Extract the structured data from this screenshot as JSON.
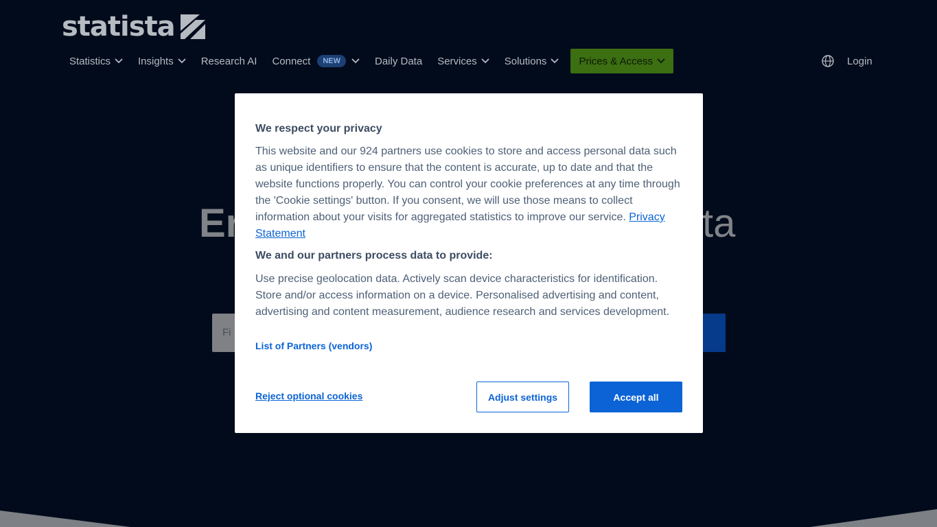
{
  "brand": {
    "name": "statista"
  },
  "nav": {
    "items": [
      {
        "label": "Statistics",
        "dropdown": true
      },
      {
        "label": "Insights",
        "dropdown": true
      },
      {
        "label": "Research AI",
        "dropdown": false
      },
      {
        "label": "Connect",
        "badge": "NEW",
        "dropdown": true
      },
      {
        "label": "Daily Data",
        "dropdown": false
      },
      {
        "label": "Services",
        "dropdown": true
      },
      {
        "label": "Solutions",
        "dropdown": true
      },
      {
        "label": "Prices & Access",
        "dropdown": true,
        "highlight": true
      }
    ],
    "login": "Login"
  },
  "hero": {
    "title_visible_start": "Er",
    "title_visible_end": "ta",
    "search_placeholder_fragment": "Fi"
  },
  "cookie_modal": {
    "title": "We respect your privacy",
    "body": "This website and our 924 partners use cookies to store and access personal data such as unique identifiers to ensure that the content is accurate, up to date and that the website functions properly. You can control your cookie preferences at any time through the 'Cookie settings' button. If you consent, we will use those means to collect information about your visits for aggregated statistics to improve our service.",
    "privacy_link": "Privacy Statement",
    "subtitle": "We and our partners process data to provide:",
    "purposes": "Use precise geolocation data. Actively scan device characteristics for identification. Store and/or access information on a device. Personalised advertising and content, advertising and content measurement, audience research and services development.",
    "partners_link": "List of Partners (vendors)",
    "reject_label": "Reject optional cookies",
    "adjust_label": "Adjust settings",
    "accept_label": "Accept all"
  },
  "colors": {
    "background": "#020b1c",
    "accent": "#0b63d6",
    "prices_button": "#3c6e12"
  }
}
